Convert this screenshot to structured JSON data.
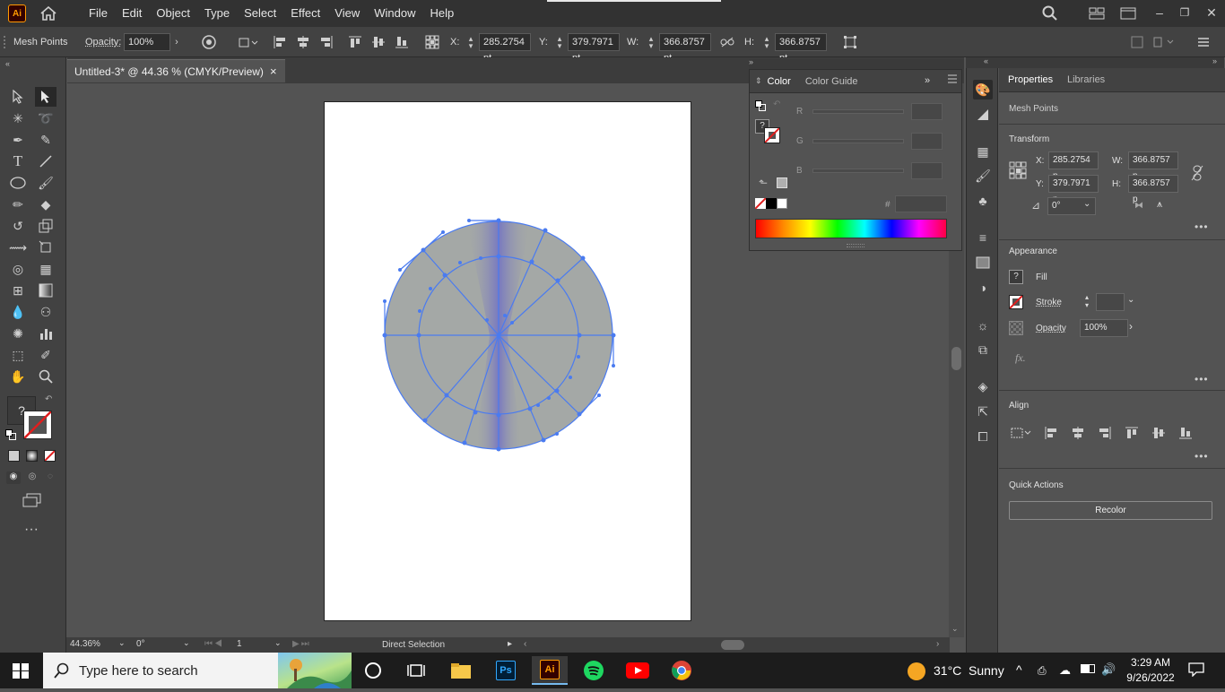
{
  "app": {
    "logo": "Ai",
    "brand_color": "#ff9a00"
  },
  "menu": [
    "File",
    "Edit",
    "Object",
    "Type",
    "Select",
    "Effect",
    "View",
    "Window",
    "Help"
  ],
  "control_bar": {
    "selection_label": "Mesh Points",
    "opacity_label": "Opacity:",
    "opacity_value": "100%",
    "x_label": "X:",
    "x_value": "285.2754 pt",
    "y_label": "Y:",
    "y_value": "379.7971 pt",
    "w_label": "W:",
    "w_value": "366.8757 pt",
    "h_label": "H:",
    "h_value": "366.8757 pt"
  },
  "document_tab": {
    "title": "Untitled-3* @ 44.36 % (CMYK/Preview)",
    "close": "×"
  },
  "color_panel": {
    "tabs": [
      "Color",
      "Color Guide"
    ],
    "sliders": [
      "R",
      "G",
      "B"
    ],
    "hex_label": "#",
    "hex_value": ""
  },
  "properties_panel": {
    "tabs": [
      "Properties",
      "Libraries"
    ],
    "selection": "Mesh Points",
    "transform": {
      "title": "Transform",
      "x_label": "X:",
      "x_value": "285.2754 p",
      "y_label": "Y:",
      "y_value": "379.7971 p",
      "w_label": "W:",
      "w_value": "366.8757 p",
      "h_label": "H:",
      "h_value": "366.8757 p",
      "angle": "0°"
    },
    "appearance": {
      "title": "Appearance",
      "fill_label": "Fill",
      "stroke_label": "Stroke",
      "opacity_label": "Opacity",
      "opacity_value": "100%",
      "fx": "fx."
    },
    "align": {
      "title": "Align"
    },
    "quick_actions": {
      "title": "Quick Actions",
      "recolor": "Recolor"
    }
  },
  "status_bar": {
    "zoom": "44.36%",
    "rotation": "0°",
    "artboard": "1",
    "tool": "Direct Selection"
  },
  "taskbar": {
    "search_placeholder": "Type here to search",
    "weather_temp": "31°C",
    "weather_desc": "Sunny",
    "time": "3:29 AM",
    "date": "9/26/2022"
  },
  "colors": {
    "mesh_fill": "#a4a8a6",
    "mesh_accent": "#7f7fc0",
    "selection": "#4a7bf0"
  }
}
